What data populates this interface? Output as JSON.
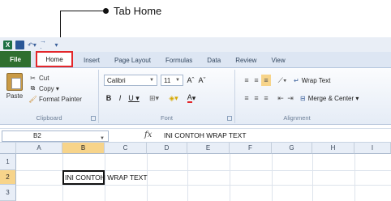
{
  "callout": {
    "label": "Tab Home"
  },
  "qat": {
    "app_logo": "X",
    "redo_icon": "→ ·"
  },
  "tabs": [
    "File",
    "Home",
    "Insert",
    "Page Layout",
    "Formulas",
    "Data",
    "Review",
    "View"
  ],
  "ribbon": {
    "clipboard": {
      "paste": "Paste",
      "cut": "Cut",
      "copy": "Copy ▾",
      "format_painter": "Format Painter",
      "label": "Clipboard"
    },
    "font": {
      "name": "Calibri",
      "size": "11",
      "bold": "B",
      "italic": "I",
      "underline": "U ▾",
      "grow": "Aˆ",
      "shrink": "Aˇ",
      "label": "Font"
    },
    "alignment": {
      "wrap_text": "Wrap Text",
      "merge_center": "Merge & Center ▾",
      "label": "Alignment"
    }
  },
  "formula_bar": {
    "name_box": "B2",
    "fx": "fx",
    "content": "INI CONTOH WRAP TEXT"
  },
  "grid": {
    "columns": [
      "A",
      "B",
      "C",
      "D",
      "E",
      "F",
      "G",
      "H",
      "I"
    ],
    "selected_column": "B",
    "rows": [
      "1",
      "2",
      "3"
    ],
    "selected_row": "2",
    "active_cell": {
      "ref": "B2",
      "value": "INI CONTOH WRAP TEXT"
    }
  },
  "colors": {
    "file_tab": "#2f6f2f",
    "home_highlight": "#e3262a",
    "selection_header": "#f7d48a"
  }
}
